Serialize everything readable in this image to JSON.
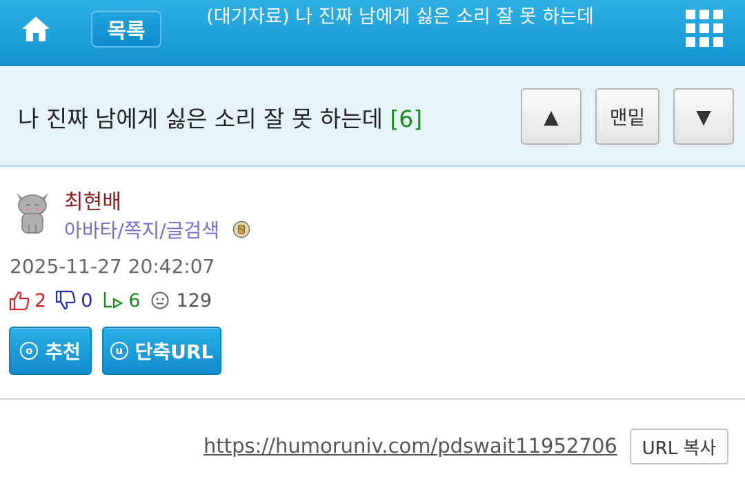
{
  "header": {
    "list_button": "목록",
    "title": "(대기자료) 나 진짜 남에게 싫은 소리 잘 못 하는데"
  },
  "post": {
    "title": "나 진짜 남에게 싫은 소리 잘 못 하는데",
    "comment_count": "[6]",
    "author": "최현배",
    "author_links": "아바타/쪽지/글검색",
    "date": "2025-11-27 20:42:07",
    "upvotes": "2",
    "downvotes": "0",
    "replies": "6",
    "views": "129",
    "url": "https://humoruniv.com/pdswait11952706"
  },
  "nav": {
    "up_symbol": "▲",
    "bottom_label": "맨밑",
    "down_symbol": "▼"
  },
  "actions": {
    "recommend_icon": "o",
    "recommend": "추천",
    "shorturl_icon": "u",
    "shorturl": "단축URL",
    "copy_url": "URL 복사"
  },
  "colors": {
    "header_blue": "#1593cf",
    "title_bar_bg": "#e6f4fa",
    "author_name": "#8a1c1c",
    "author_links": "#7070cc",
    "upvote_red": "#d82020",
    "downvote_blue": "#1a2ab8",
    "reply_green": "#1a8a1a"
  },
  "icons": [
    "home-icon",
    "grid-menu-icon",
    "thumbs-up-icon",
    "thumbs-down-icon",
    "reply-icon",
    "view-face-icon",
    "member-level-icon"
  ]
}
